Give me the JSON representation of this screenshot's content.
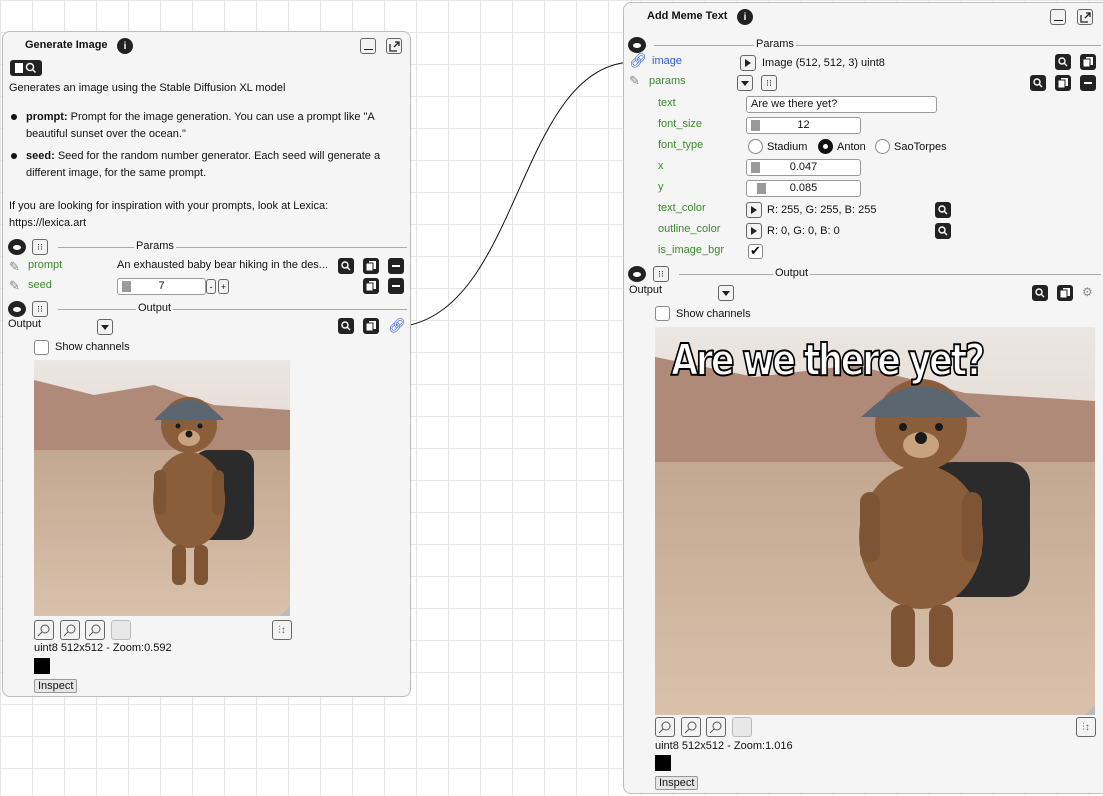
{
  "left_node": {
    "title": "Generate Image",
    "description": "Generates an image using the Stable Diffusion XL model",
    "bullets": [
      {
        "term": "prompt:",
        "text": "Prompt for the image generation. You can use a prompt like \"A beautiful sunset over the ocean.\""
      },
      {
        "term": "seed:",
        "text": "Seed for the random number generator. Each seed will generate a different image, for the same prompt."
      }
    ],
    "inspiration": "If you are looking for inspiration with your prompts, look at Lexica:",
    "inspiration_link": "https://lexica.art",
    "params_label": "Params",
    "params": {
      "prompt_label": "prompt",
      "prompt_value": "An exhausted baby bear hiking in the des...",
      "seed_label": "seed",
      "seed_value": "7",
      "seed_minus": "-",
      "seed_plus": "+"
    },
    "output_section_label": "Output",
    "output_label": "Output",
    "show_channels": "Show channels",
    "image_info": "uint8 512x512 - Zoom:0.592",
    "inspect": "Inspect"
  },
  "right_node": {
    "title": "Add Meme Text",
    "params_label": "Params",
    "image_label": "image",
    "image_value": "Image (512, 512, 3) uint8",
    "params_group_label": "params",
    "fields": {
      "text_label": "text",
      "text_value": "Are we there yet?",
      "font_size_label": "font_size",
      "font_size_value": "12",
      "font_type_label": "font_type",
      "font_options": [
        "Stadium",
        "Anton",
        "SaoTorpes"
      ],
      "font_selected": "Anton",
      "x_label": "x",
      "x_value": "0.047",
      "y_label": "y",
      "y_value": "0.085",
      "text_color_label": "text_color",
      "text_color_value": "R: 255, G: 255, B: 255",
      "outline_color_label": "outline_color",
      "outline_color_value": "R: 0, G: 0, B: 0",
      "is_image_bgr_label": "is_image_bgr",
      "is_image_bgr_checked": true
    },
    "output_section_label": "Output",
    "output_label": "Output",
    "show_channels": "Show channels",
    "meme_text": "Are we there yet?",
    "image_info": "uint8 512x512 - Zoom:1.016",
    "inspect": "Inspect"
  },
  "colors": {
    "param_label": "#3a8a2a",
    "link_blue": "#2a5bd7",
    "node_bg": "#f5f5f5"
  },
  "icons": [
    "info-icon",
    "minimize-icon",
    "popout-icon",
    "save-zoom-icon",
    "eye-icon",
    "collapse-icon",
    "pencil-icon",
    "link-icon",
    "zoom-icon",
    "copy-icon",
    "minus-icon",
    "dropdown-icon",
    "play-arrow-icon",
    "checkmark-icon",
    "fit-icon",
    "zoom-in-icon",
    "zoom-out-icon",
    "settings-icon"
  ]
}
